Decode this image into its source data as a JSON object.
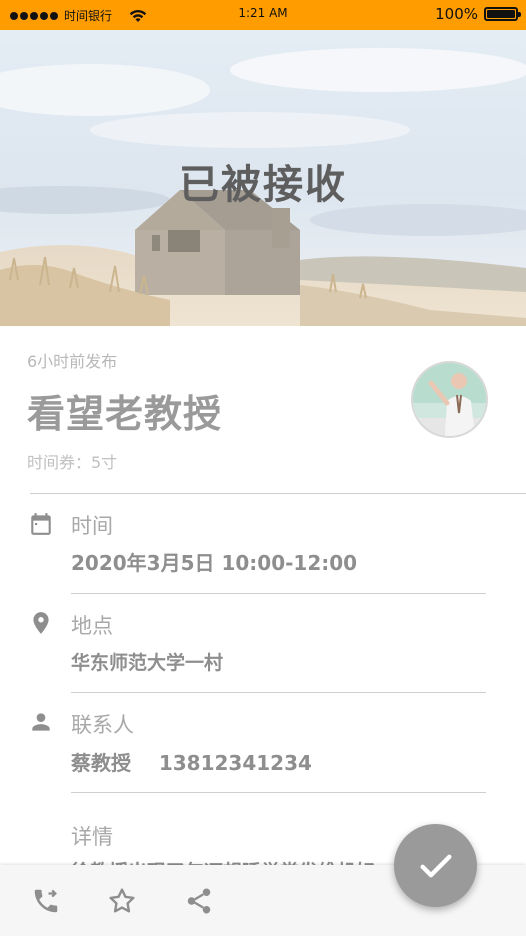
{
  "status_bar": {
    "carrier": "时间银行",
    "time": "1:21 AM",
    "battery": "100%"
  },
  "hero": {
    "title": "已被接收"
  },
  "task": {
    "posted": "6小时前发布",
    "title": "看望老教授",
    "voucher": "时间券：5寸"
  },
  "details": {
    "time": {
      "label": "时间",
      "value": "2020年3月5日 10:00-12:00",
      "icon": "calendar-icon"
    },
    "location": {
      "label": "地点",
      "value": "华东师范大学一村",
      "icon": "location-pin-icon"
    },
    "contact": {
      "label": "联系人",
      "value": "蔡教授    13812341234",
      "icon": "person-icon"
    },
    "description": {
      "label": "详情",
      "value": "徐教授出现了年迈想睡觉常发维机好"
    }
  },
  "bottom_bar": {
    "icons": [
      "phone-forward-icon",
      "star-icon",
      "share-icon"
    ]
  },
  "fab": {
    "icon": "check-icon"
  },
  "colors": {
    "status_bar": "#ff9d00",
    "fab": "#9a9a9a"
  }
}
